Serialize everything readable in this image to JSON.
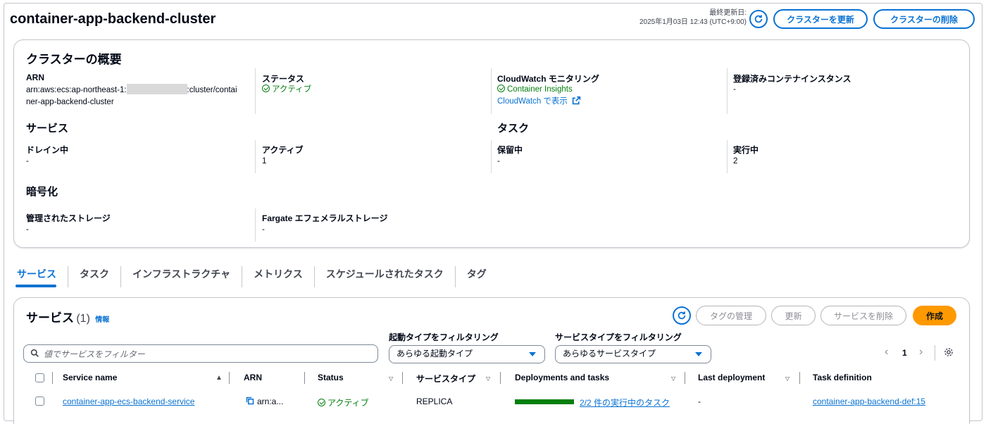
{
  "header": {
    "title": "container-app-backend-cluster",
    "updated_label": "最終更新日:",
    "updated_value": "2025年1月03日 12:43 (UTC+9:00)",
    "update_button": "クラスターを更新",
    "delete_button": "クラスターの削除"
  },
  "overview": {
    "heading": "クラスターの概要",
    "arn_label": "ARN",
    "arn_prefix": "arn:aws:ecs:ap-northeast-1:",
    "arn_suffix": ":cluster/contai",
    "arn_line2": "ner-app-backend-cluster",
    "status_label": "ステータス",
    "status_value": "アクティブ",
    "cloudwatch_label": "CloudWatch モニタリング",
    "cloudwatch_value": "Container Insights",
    "cloudwatch_link": "CloudWatch で表示",
    "registered_label": "登録済みコンテナインスタンス",
    "registered_value": "-",
    "services_heading": "サービス",
    "draining_label": "ドレイン中",
    "draining_value": "-",
    "active_label": "アクティブ",
    "active_value": "1",
    "tasks_heading": "タスク",
    "pending_label": "保留中",
    "pending_value": "-",
    "running_label": "実行中",
    "running_value": "2",
    "encryption_heading": "暗号化",
    "managed_storage_label": "管理されたストレージ",
    "managed_storage_value": "-",
    "fargate_label": "Fargate エフェメラルストレージ",
    "fargate_value": "-"
  },
  "tabs": [
    "サービス",
    "タスク",
    "インフラストラクチャ",
    "メトリクス",
    "スケジュールされたタスク",
    "タグ"
  ],
  "services": {
    "heading": "サービス",
    "count": "(1)",
    "info": "情報",
    "manage_tags": "タグの管理",
    "update": "更新",
    "delete_service": "サービスを削除",
    "create": "作成",
    "launch_filter_label": "起動タイプをフィルタリング",
    "launch_filter_value": "あらゆる起動タイプ",
    "service_filter_label": "サービスタイプをフィルタリング",
    "service_filter_value": "あらゆるサービスタイプ",
    "search_placeholder": "値でサービスをフィルター",
    "page": "1",
    "columns": [
      "Service name",
      "ARN",
      "Status",
      "サービスタイプ",
      "Deployments and tasks",
      "Last deployment",
      "Task definition"
    ],
    "rows": [
      {
        "service_name": "container-app-ecs-backend-service",
        "arn": "arn:a...",
        "status": "アクティブ",
        "service_type": "REPLICA",
        "deployments": "2/2 件の実行中のタスク",
        "deployments_fraction": 1.0,
        "last_deployment": "-",
        "task_definition": "container-app-backend-def:15"
      }
    ]
  }
}
